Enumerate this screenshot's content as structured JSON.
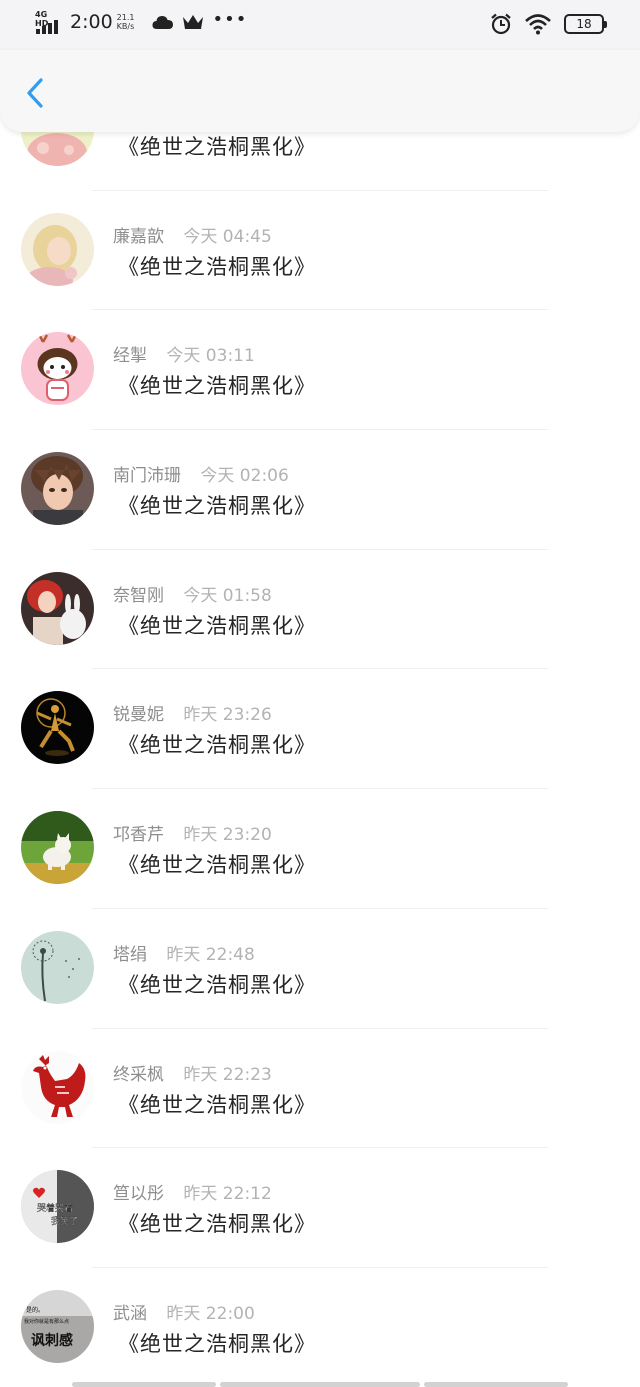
{
  "status_bar": {
    "network": "4G HD",
    "time": "2:00",
    "speed_value": "21.1",
    "speed_unit": "KB/s",
    "battery": "18",
    "more": "•••"
  },
  "header": {
    "back_icon": "chevron-left-icon"
  },
  "comments": [
    {
      "name": "",
      "time": "",
      "text": "《绝世之浩桐黑化》",
      "avatar": "pink-girl"
    },
    {
      "name": "廉嘉歆",
      "time": "今天 04:45",
      "text": "《绝世之浩桐黑化》",
      "avatar": "blonde-girl"
    },
    {
      "name": "经掣",
      "time": "今天 03:11",
      "text": "《绝世之浩桐黑化》",
      "avatar": "cartoon-deer"
    },
    {
      "name": "南门沛珊",
      "time": "今天 02:06",
      "text": "《绝世之浩桐黑化》",
      "avatar": "anime-boy"
    },
    {
      "name": "奈智刚",
      "time": "今天 01:58",
      "text": "《绝世之浩桐黑化》",
      "avatar": "girl-with-rabbit"
    },
    {
      "name": "锐曼妮",
      "time": "昨天 23:26",
      "text": "《绝世之浩桐黑化》",
      "avatar": "golden-dancer"
    },
    {
      "name": "邛香芹",
      "time": "昨天 23:20",
      "text": "《绝世之浩桐黑化》",
      "avatar": "white-kitten"
    },
    {
      "name": "塔绢",
      "time": "昨天 22:48",
      "text": "《绝世之浩桐黑化》",
      "avatar": "dandelion"
    },
    {
      "name": "终采枫",
      "time": "昨天 22:23",
      "text": "《绝世之浩桐黑化》",
      "avatar": "red-rooster"
    },
    {
      "name": "笪以彤",
      "time": "昨天 22:12",
      "text": "《绝世之浩桐黑化》",
      "avatar": "text-meme"
    },
    {
      "name": "武涵",
      "time": "昨天 22:00",
      "text": "《绝世之浩桐黑化》",
      "avatar": "sarcasm-text"
    }
  ],
  "avatar_texts": {
    "meme_line1": "哭着哭着",
    "meme_line2": "我笑了",
    "sarcasm_line1": "是的。",
    "sarcasm_line2": "我对你就是有那么点",
    "sarcasm_big": "讽刺感"
  },
  "colors": {
    "accent": "#2e9ef0",
    "name": "#8e8e8e",
    "time": "#b3b3b3",
    "text": "#262626"
  }
}
